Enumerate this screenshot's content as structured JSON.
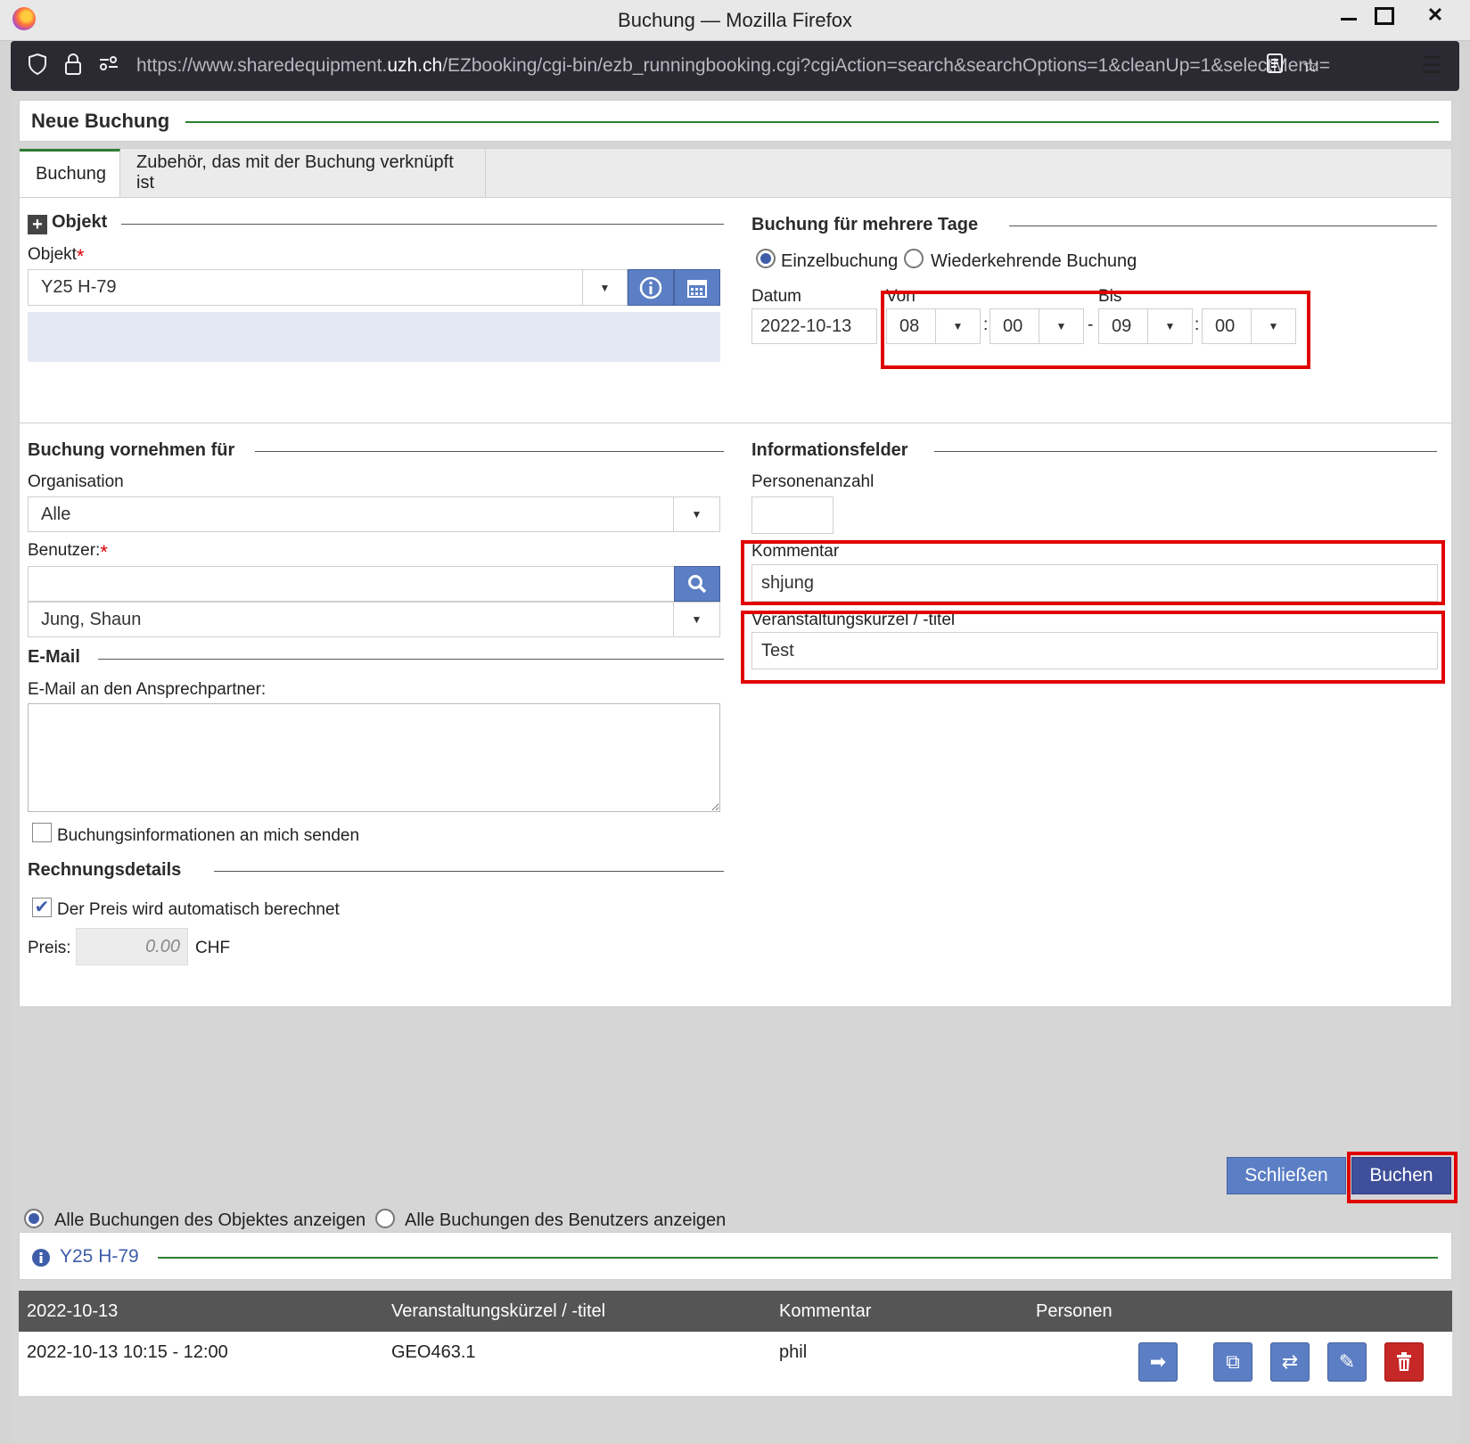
{
  "window": {
    "title": "Buchung — Mozilla Firefox"
  },
  "browser": {
    "url_prefix": "https://www.sharedequipment.",
    "url_domain": "uzh.ch",
    "url_rest": "/EZbooking/cgi-bin/ezb_runningbooking.cgi?cgiAction=search&searchOptions=1&cleanUp=1&selectMenu="
  },
  "header": {
    "title": "Neue Buchung"
  },
  "tabs": [
    {
      "label": "Buchung"
    },
    {
      "label": "Zubehör, das mit der Buchung verknüpft ist"
    }
  ],
  "objekt": {
    "section_title": "Objekt",
    "field_label": "Objekt",
    "value": "Y25 H-79"
  },
  "mehrere_tage": {
    "section_title": "Buchung für mehrere Tage",
    "option_single": "Einzelbuchung",
    "option_recurring": "Wiederkehrende Buchung",
    "date_label": "Datum",
    "date_value": "2022-10-13",
    "from_label": "Von",
    "to_label": "Bis",
    "from_hour": "08",
    "from_min": "00",
    "to_hour": "09",
    "to_min": "00",
    "colon": ":",
    "dash": "-"
  },
  "booking_for": {
    "section_title": "Buchung vornehmen für",
    "org_label": "Organisation",
    "org_value": "Alle",
    "user_label": "Benutzer:",
    "user_search_value": "",
    "user_value": "Jung, Shaun"
  },
  "email": {
    "section_title": "E-Mail",
    "label": "E-Mail an den Ansprechpartner:",
    "value": "",
    "send_me_label": "Buchungsinformationen an mich senden"
  },
  "billing": {
    "section_title": "Rechnungsdetails",
    "auto_price_label": "Der Preis wird automatisch berechnet",
    "price_label": "Preis:",
    "price_value": "0.00",
    "currency": "CHF"
  },
  "info": {
    "section_title": "Informationsfelder",
    "persons_label": "Personenanzahl",
    "persons_value": "",
    "comment_label": "Kommentar",
    "comment_value": "shjung",
    "event_label": "Veranstaltungskürzel / -titel",
    "event_value": "Test"
  },
  "actions": {
    "close_label": "Schließen",
    "book_label": "Buchen"
  },
  "list_filter": {
    "object_option": "Alle Buchungen des Objektes anzeigen",
    "user_option": "Alle Buchungen des Benutzers anzeigen"
  },
  "object_header": {
    "name": "Y25 H-79"
  },
  "bookings_table": {
    "columns": [
      "2022-10-13",
      "Veranstaltungskürzel / -titel",
      "Kommentar",
      "Personen"
    ],
    "rows": [
      {
        "time": "2022-10-13 10:15 - 12:00",
        "event": "GEO463.1",
        "comment": "phil",
        "persons": ""
      }
    ]
  },
  "icons": [
    "shield-icon",
    "lock-icon",
    "permissions-icon",
    "reader-view-icon",
    "bookmark-star-icon",
    "hamburger-menu-icon",
    "info-icon",
    "calendar-icon",
    "search-icon",
    "chevron-down-icon",
    "arrow-right-icon",
    "copy-icon",
    "swap-icon",
    "edit-icon",
    "delete-icon"
  ],
  "colors": {
    "accent_green": "#2e7d32",
    "button_blue": "#5b7ec4",
    "button_dark": "#3f4f9a",
    "highlight_red": "#e00000",
    "delete_red": "#c62828"
  }
}
